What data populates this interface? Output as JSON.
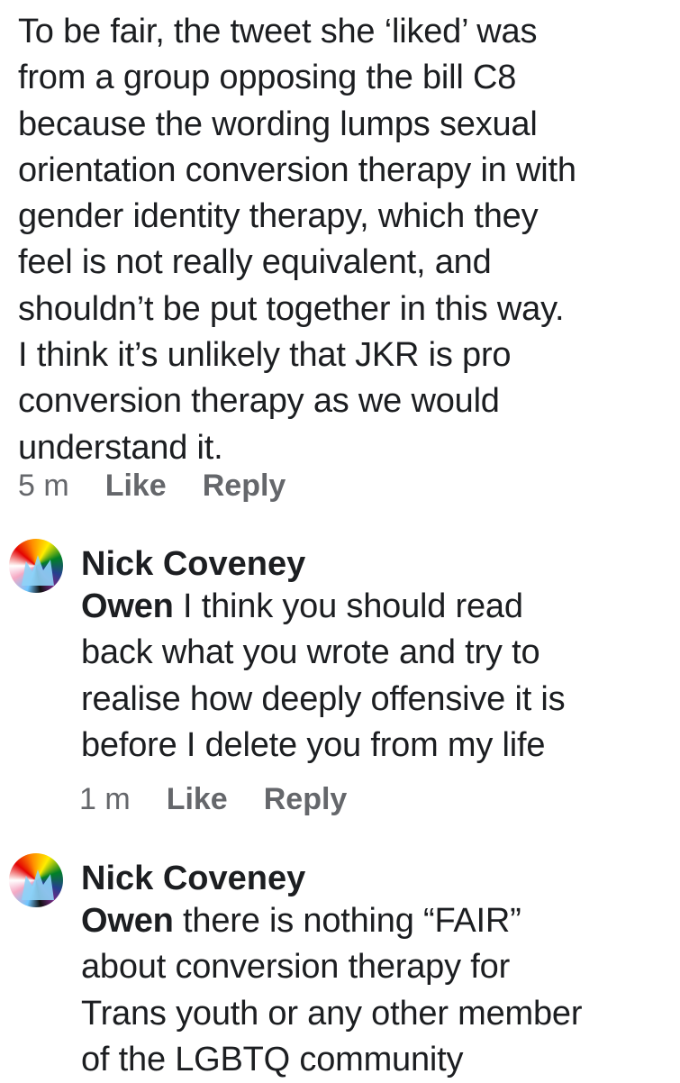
{
  "comments": [
    {
      "lines": [
        "To be fair, the tweet she ‘liked’ was",
        "from a group opposing the bill  C8",
        "because the wording lumps sexual",
        "orientation conversion therapy in with",
        "gender identity therapy, which they",
        "feel is not really equivalent, and",
        "shouldn’t be put together in this way.",
        "I think it’s unlikely that JKR is pro",
        "conversion therapy as we would",
        "understand it."
      ],
      "time": "5 m",
      "like": "Like",
      "reply": "Reply"
    },
    {
      "author": "Nick Coveney",
      "avatar_icon": "pride-flag-avatar-icon",
      "mention": "Owen",
      "first_line_rest": " I think you should read",
      "lines": [
        "back what you wrote and try to",
        "realise how deeply offensive it is",
        "before I delete you from my life"
      ],
      "time": "1 m",
      "like": "Like",
      "reply": "Reply"
    },
    {
      "author": "Nick Coveney",
      "avatar_icon": "pride-flag-avatar-icon",
      "mention": "Owen",
      "first_line_rest": " there is nothing “FAIR”",
      "lines": [
        "about conversion therapy for",
        "Trans youth or any other member",
        "of the LGBTQ community"
      ]
    }
  ],
  "colors": {
    "text": "#1c1e21",
    "meta": "#65676b",
    "background": "#ffffff"
  }
}
